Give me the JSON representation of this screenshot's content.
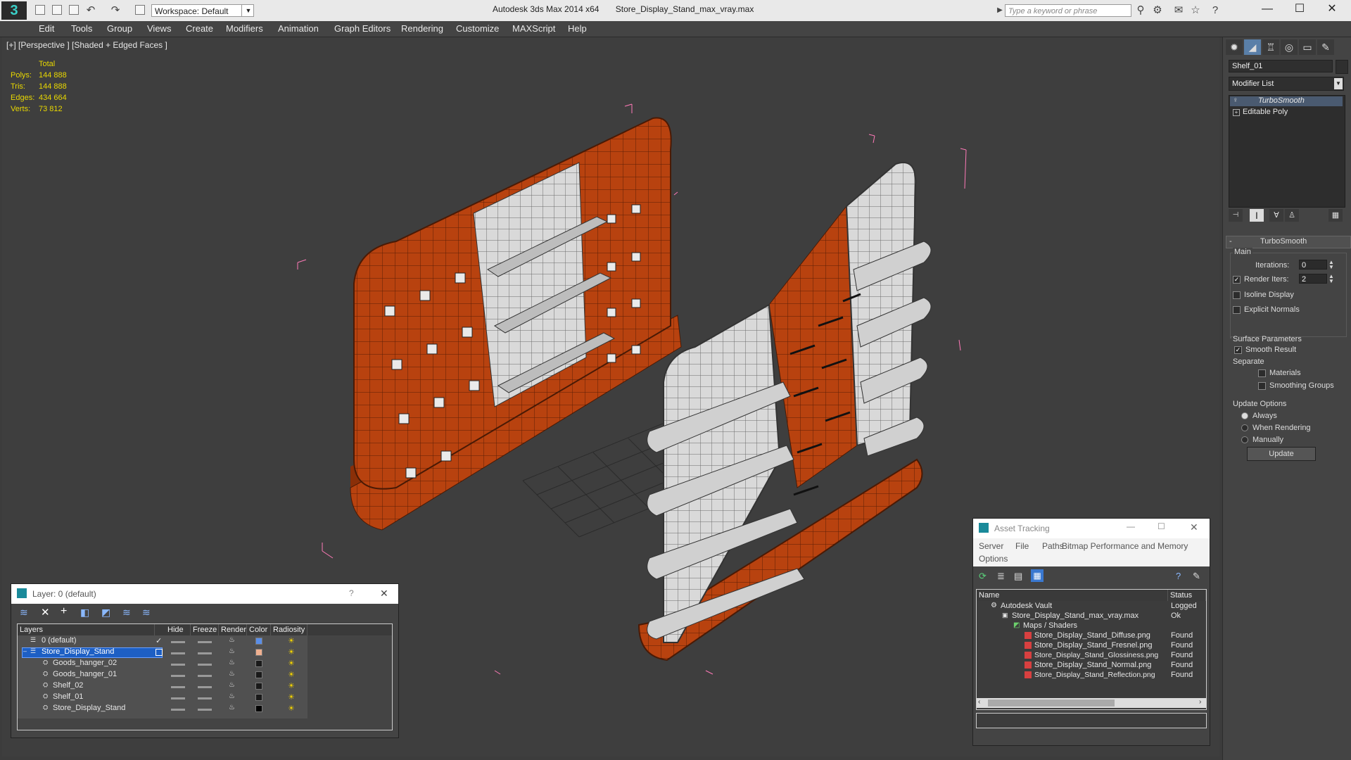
{
  "titlebar": {
    "logo": "3",
    "workspace": "Workspace: Default",
    "app_name": "Autodesk 3ds Max  2014 x64",
    "file_name": "Store_Display_Stand_max_vray.max",
    "search_placeholder": "Type a keyword or phrase",
    "win_minimize": "—",
    "win_maximize": "☐",
    "win_close": "✕"
  },
  "menu": [
    "Edit",
    "Tools",
    "Group",
    "Views",
    "Create",
    "Modifiers",
    "Animation",
    "Graph Editors",
    "Rendering",
    "Customize",
    "MAXScript",
    "Help"
  ],
  "viewport": {
    "label": "[+] [Perspective ] [Shaded + Edged Faces ]",
    "stats": {
      "header": "Total",
      "rows": [
        {
          "label": "Polys:",
          "value": "144 888"
        },
        {
          "label": "Tris:",
          "value": "144 888"
        },
        {
          "label": "Edges:",
          "value": "434 664"
        },
        {
          "label": "Verts:",
          "value": "73 812"
        }
      ]
    }
  },
  "command_panel": {
    "object_name": "Shelf_01",
    "modifier_list": "Modifier List",
    "stack": [
      "TurboSmooth",
      "Editable Poly"
    ],
    "rollout_title": "TurboSmooth",
    "main_label": "Main",
    "iterations_label": "Iterations:",
    "iterations_value": "0",
    "render_iters_label": "Render Iters:",
    "render_iters_value": "2",
    "isoline": "Isoline Display",
    "explicit_normals": "Explicit Normals",
    "surface_params": "Surface Parameters",
    "smooth_result": "Smooth Result",
    "separate": "Separate",
    "materials": "Materials",
    "smoothing_groups": "Smoothing Groups",
    "update_options": "Update Options",
    "always": "Always",
    "when_rendering": "When Rendering",
    "manually": "Manually",
    "update_button": "Update"
  },
  "layer_dialog": {
    "title": "Layer: 0 (default)",
    "help": "?",
    "close": "✕",
    "columns": [
      "Layers",
      "Hide",
      "Freeze",
      "Render",
      "Color",
      "Radiosity"
    ],
    "rows": [
      {
        "name": "0 (default)",
        "color": "#5a8ee8"
      },
      {
        "name": "Store_Display_Stand",
        "color": "#f0b090"
      },
      {
        "name": "Goods_hanger_02",
        "color": "#1a1a1a"
      },
      {
        "name": "Goods_hanger_01",
        "color": "#1a1a1a"
      },
      {
        "name": "Shelf_02",
        "color": "#1a1a1a"
      },
      {
        "name": "Shelf_01",
        "color": "#1a1a1a"
      },
      {
        "name": "Store_Display_Stand",
        "color": "#000000"
      }
    ],
    "dash": "▬▬"
  },
  "asset_dialog": {
    "title": "Asset Tracking",
    "menu": [
      "Server",
      "File",
      "Paths",
      "Bitmap Performance and Memory",
      "Options"
    ],
    "columns": [
      "Name",
      "Status"
    ],
    "rows": [
      {
        "name": "Autodesk Vault",
        "status": "Logged"
      },
      {
        "name": "Store_Display_Stand_max_vray.max",
        "status": "Ok"
      },
      {
        "name": "Maps / Shaders",
        "status": ""
      },
      {
        "name": "Store_Display_Stand_Diffuse.png",
        "status": "Found"
      },
      {
        "name": "Store_Display_Stand_Fresnel.png",
        "status": "Found"
      },
      {
        "name": "Store_Display_Stand_Glossiness.png",
        "status": "Found"
      },
      {
        "name": "Store_Display_Stand_Normal.png",
        "status": "Found"
      },
      {
        "name": "Store_Display_Stand_Reflection.png",
        "status": "Found"
      }
    ]
  },
  "colors": {
    "orange": "#b8420f",
    "white_panel": "#d8d8d8",
    "stats": "#e9d800",
    "selection": "#1d5fc4"
  }
}
